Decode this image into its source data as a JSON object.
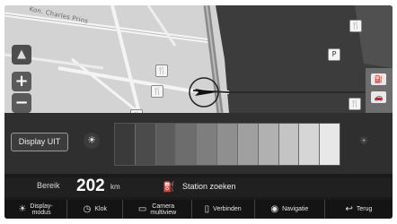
{
  "map": {
    "street_name": "Kon. Charles Prins",
    "zoom_in_label": "+",
    "zoom_out_label": "−",
    "poi_icons": [
      "fork-knife-icon",
      "fork-knife-icon",
      "fork-knife-icon",
      "fork-knife-icon",
      "fork-knife-icon",
      "parking-icon"
    ]
  },
  "brightness": {
    "display_off_label": "Display UIT",
    "levels": [
      "#3a3a3a",
      "#4b4b4b",
      "#5c5c5c",
      "#6d6d6d",
      "#7e7e7e",
      "#8f8f8f",
      "#a0a0a0",
      "#b1b1b1",
      "#c4c4c4",
      "#d6d6d6",
      "#e8e8e8"
    ]
  },
  "info": {
    "range_label": "Bereik",
    "range_value": "202",
    "range_unit": "km",
    "station_label": "Station zoeken"
  },
  "nav": {
    "display_mode": "Display-\nmodus",
    "clock": "Klok",
    "camera": "Camera\nmultiview",
    "connect": "Verbinden",
    "navigation": "Navigatie",
    "back": "Terug"
  }
}
